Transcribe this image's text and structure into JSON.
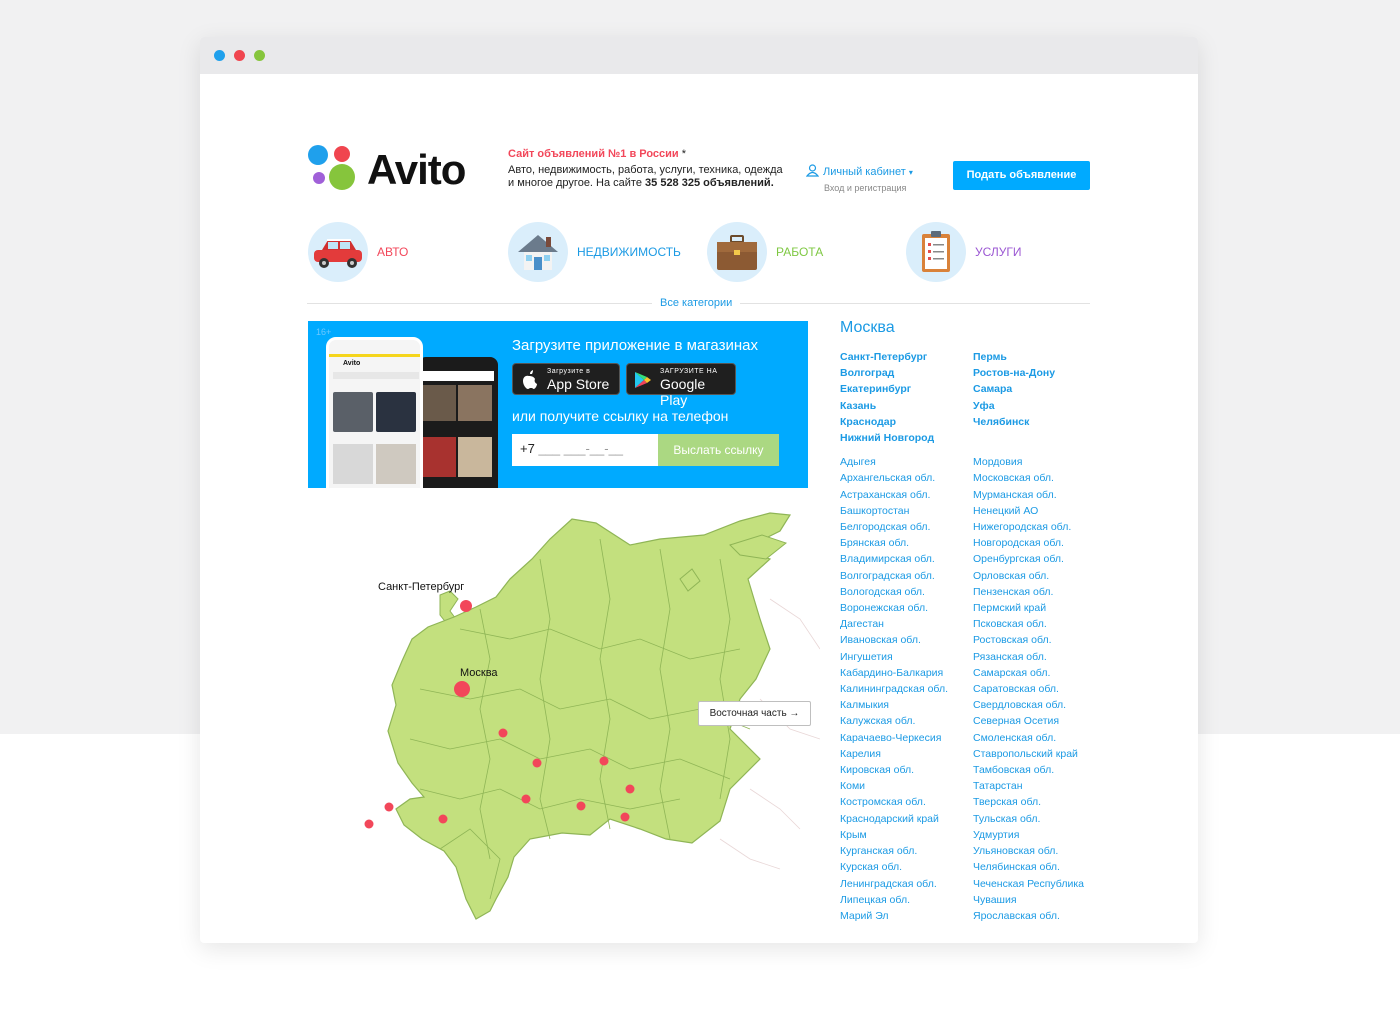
{
  "logo": {
    "text": "Avito"
  },
  "header": {
    "tagline_highlight": "Сайт объявлений №1 в России",
    "tagline_star": "*",
    "tagline_text": "Авто, недвижимость, работа, услуги, техника, одежда и многое другое. На сайте",
    "tagline_count": "35 528 325 объявлений.",
    "cabinet_label": "Личный кабинет",
    "cabinet_sub": "Вход и регистрация",
    "post_button": "Подать объявление"
  },
  "categories": [
    {
      "label": "АВТО",
      "icon": "car-icon",
      "color": "#f2475a"
    },
    {
      "label": "НЕДВИЖИМОСТЬ",
      "icon": "house-icon",
      "color": "#1b9ae4"
    },
    {
      "label": "РАБОТА",
      "icon": "briefcase-icon",
      "color": "#7fc843"
    },
    {
      "label": "УСЛУГИ",
      "icon": "clipboard-icon",
      "color": "#9b57d3"
    }
  ],
  "all_categories": "Все категории",
  "banner": {
    "age": "16+",
    "title": "Загрузите приложение в магазинах",
    "appstore_small": "Загрузите в",
    "appstore_big": "App Store",
    "googleplay_small": "ЗАГРУЗИТЕ НА",
    "googleplay_big": "Google Play",
    "subtitle": "или получите ссылку на телефон",
    "phone_prefix": "+7",
    "phone_mask": "___ ___-__-__",
    "send_button": "Выслать ссылку",
    "phone_app_name": "Avito"
  },
  "map": {
    "label_spb": "Санкт-Петербург",
    "label_msk": "Москва",
    "east_button": "Восточная часть →",
    "land_color": "#c3e07e",
    "dot_color": "#f2475a"
  },
  "regions": {
    "current_city": "Москва",
    "big_cities_left": [
      "Санкт-Петербург",
      "Волгоград",
      "Екатеринбург",
      "Казань",
      "Краснодар",
      "Нижний Новгород"
    ],
    "big_cities_right": [
      "Пермь",
      "Ростов-на-Дону",
      "Самара",
      "Уфа",
      "Челябинск"
    ],
    "regions_left": [
      "Адыгея",
      "Архангельская обл.",
      "Астраханская обл.",
      "Башкортостан",
      "Белгородская обл.",
      "Брянская обл.",
      "Владимирская обл.",
      "Волгоградская обл.",
      "Вологодская обл.",
      "Воронежская обл.",
      "Дагестан",
      "Ивановская обл.",
      "Ингушетия",
      "Кабардино-Балкария",
      "Калининградская обл.",
      "Калмыкия",
      "Калужская обл.",
      "Карачаево-Черкесия",
      "Карелия",
      "Кировская обл.",
      "Коми",
      "Костромская обл.",
      "Краснодарский край",
      "Крым",
      "Курганская обл.",
      "Курская обл.",
      "Ленинградская обл.",
      "Липецкая обл.",
      "Марий Эл"
    ],
    "regions_right": [
      "Мордовия",
      "Московская обл.",
      "Мурманская обл.",
      "Ненецкий АО",
      "Нижегородская обл.",
      "Новгородская обл.",
      "Оренбургская обл.",
      "Орловская обл.",
      "Пензенская обл.",
      "Пермский край",
      "Псковская обл.",
      "Ростовская обл.",
      "Рязанская обл.",
      "Самарская обл.",
      "Саратовская обл.",
      "Свердловская обл.",
      "Северная Осетия",
      "Смоленская обл.",
      "Ставропольский край",
      "Тамбовская обл.",
      "Татарстан",
      "Тверская обл.",
      "Тульская обл.",
      "Удмуртия",
      "Ульяновская обл.",
      "Челябинская обл.",
      "Чеченская Республика",
      "Чувашия",
      "Ярославская обл."
    ]
  }
}
